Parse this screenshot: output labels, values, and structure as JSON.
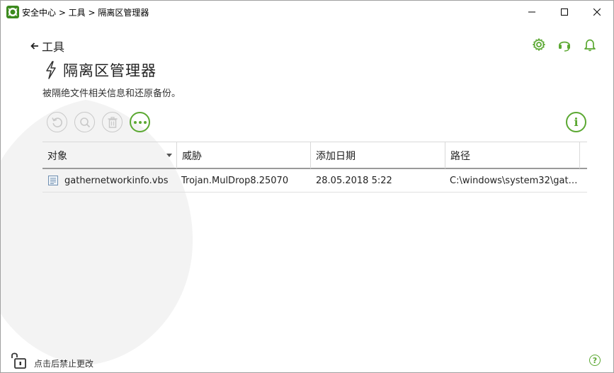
{
  "window": {
    "title": "安全中心 > 工具 > 隔离区管理器"
  },
  "header": {
    "back_label": "工具",
    "page_title": "隔离区管理器",
    "description": "被隔绝文件相关信息和还原备份。"
  },
  "table": {
    "columns": [
      "对象",
      "威胁",
      "添加日期",
      "路径"
    ],
    "rows": [
      {
        "object": "gathernetworkinfo.vbs",
        "threat": "Trojan.MulDrop8.25070",
        "date": "28.05.2018 5:22",
        "path": "C:\\windows\\system32\\gath..."
      }
    ]
  },
  "footer": {
    "lock_label": "点击后禁止更改",
    "help_label": "?"
  },
  "info_label": "i",
  "colors": {
    "accent": "#5ba832",
    "disabled": "#c9c9c9"
  }
}
